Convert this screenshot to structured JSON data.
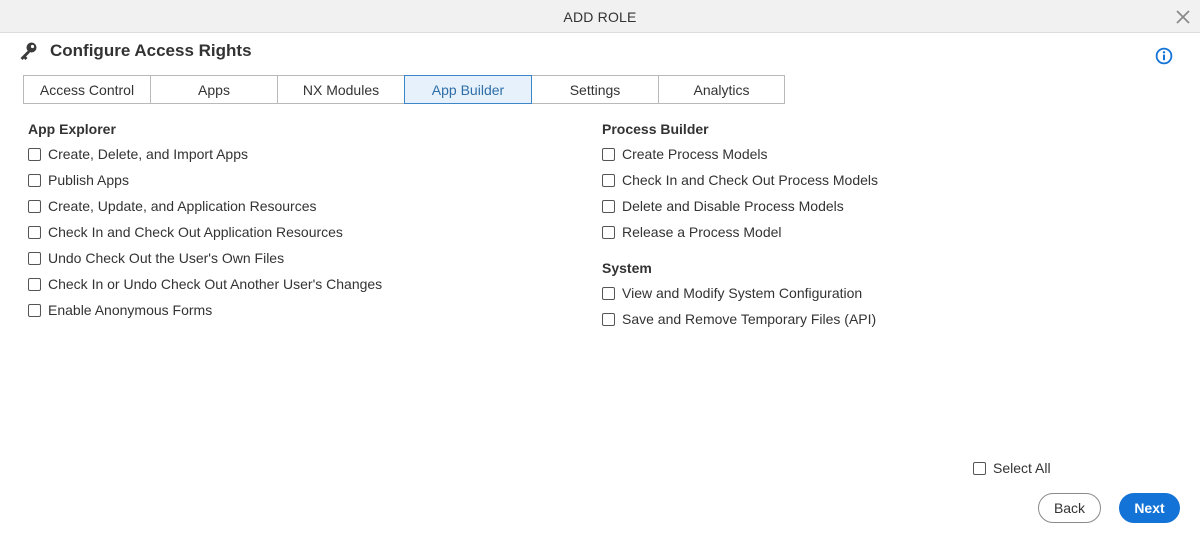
{
  "dialog": {
    "title": "ADD ROLE"
  },
  "header": {
    "title": "Configure Access Rights"
  },
  "tabs": [
    {
      "label": "Access Control",
      "active": false
    },
    {
      "label": "Apps",
      "active": false
    },
    {
      "label": "NX Modules",
      "active": false
    },
    {
      "label": "App Builder",
      "active": true
    },
    {
      "label": "Settings",
      "active": false
    },
    {
      "label": "Analytics",
      "active": false
    }
  ],
  "app_explorer": {
    "title": "App Explorer",
    "options": [
      "Create, Delete, and Import Apps",
      "Publish Apps",
      "Create, Update, and Application Resources",
      "Check In and Check Out Application Resources",
      "Undo Check Out the User's Own Files",
      "Check In or Undo Check Out Another User's Changes",
      "Enable Anonymous Forms"
    ]
  },
  "process_builder": {
    "title": "Process Builder",
    "options": [
      "Create Process Models",
      "Check In and Check Out Process Models",
      "Delete and Disable Process Models",
      "Release a Process Model"
    ]
  },
  "system": {
    "title": "System",
    "options": [
      "View and Modify System Configuration",
      "Save and Remove Temporary Files (API)"
    ]
  },
  "footer": {
    "select_all": "Select All",
    "back": "Back",
    "next": "Next"
  },
  "colors": {
    "accent": "#1473d6",
    "active_tab_bg": "#e6f1fb",
    "titlebar_bg": "#f1f1f1"
  },
  "icons": {
    "close": "close-icon",
    "key": "key-icon",
    "info": "info-icon",
    "checkbox": "checkbox-icon"
  }
}
